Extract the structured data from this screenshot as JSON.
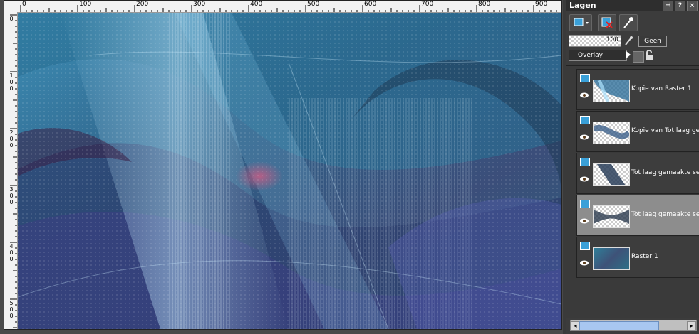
{
  "ruler": {
    "top_labels": [
      "0",
      "100",
      "200",
      "300",
      "400",
      "500",
      "600",
      "700",
      "800",
      "900"
    ],
    "left_labels": [
      "0",
      "100",
      "200",
      "300",
      "400",
      "500"
    ]
  },
  "panel": {
    "title": "Lagen",
    "opacity": "100",
    "mask_value": "Geen",
    "blend_mode": "Overlay",
    "colors": {
      "header": "#2e2e2e",
      "selected": "#8d8d8d",
      "accent": "#3aa0d8"
    }
  },
  "layers": [
    {
      "name": "Kopie van Raster 1",
      "selected": false,
      "type_icon": "raster-layer-icon"
    },
    {
      "name": "Kopie van Tot laag gemaakte selectie",
      "selected": false,
      "type_icon": "raster-layer-icon"
    },
    {
      "name": "Tot laag gemaakte selectie",
      "selected": false,
      "type_icon": "raster-layer-icon"
    },
    {
      "name": "Tot laag gemaakte selectie",
      "selected": true,
      "type_icon": "raster-layer-icon"
    },
    {
      "name": "Raster 1",
      "selected": false,
      "type_icon": "raster-layer-icon"
    }
  ]
}
